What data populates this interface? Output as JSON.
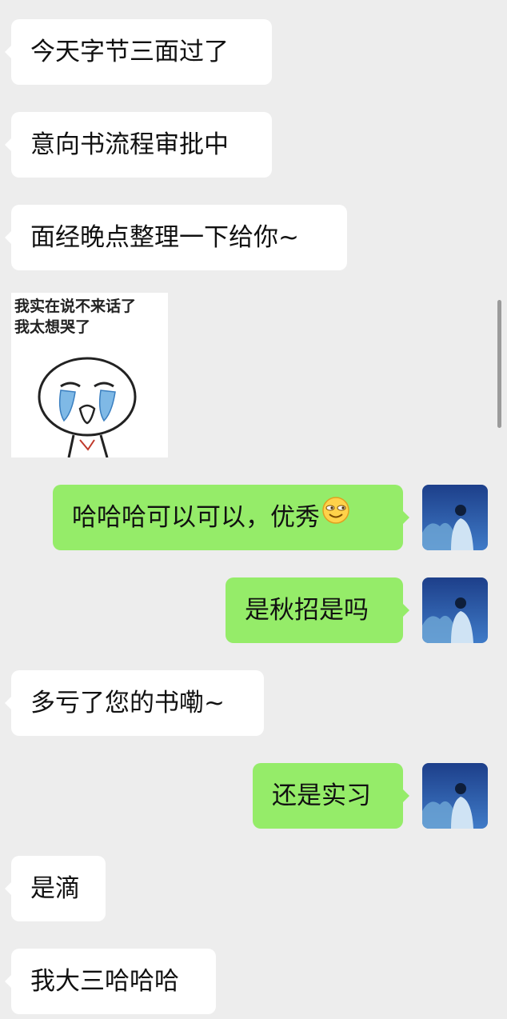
{
  "messages": [
    {
      "side": "left",
      "text": "今天字节三面过了"
    },
    {
      "side": "left",
      "text": "意向书流程审批中"
    },
    {
      "side": "left",
      "text": "面经晚点整理一下给你~"
    },
    {
      "side": "left",
      "sticker_text": [
        "我实在说不来话了",
        "我太想哭了"
      ]
    },
    {
      "side": "right",
      "text": "哈哈哈可以可以，优秀",
      "emoji": "smirk-emoji"
    },
    {
      "side": "right",
      "text": "是秋招是吗"
    },
    {
      "side": "left",
      "text": "多亏了您的书嘞~"
    },
    {
      "side": "right",
      "text": "还是实习"
    },
    {
      "side": "left",
      "text": "是滴"
    },
    {
      "side": "left",
      "text": "我大三哈哈哈"
    }
  ],
  "colors": {
    "background": "#ededed",
    "incoming_bubble": "#ffffff",
    "outgoing_bubble": "#95ec69",
    "avatar_sky": "#2f5fae"
  }
}
